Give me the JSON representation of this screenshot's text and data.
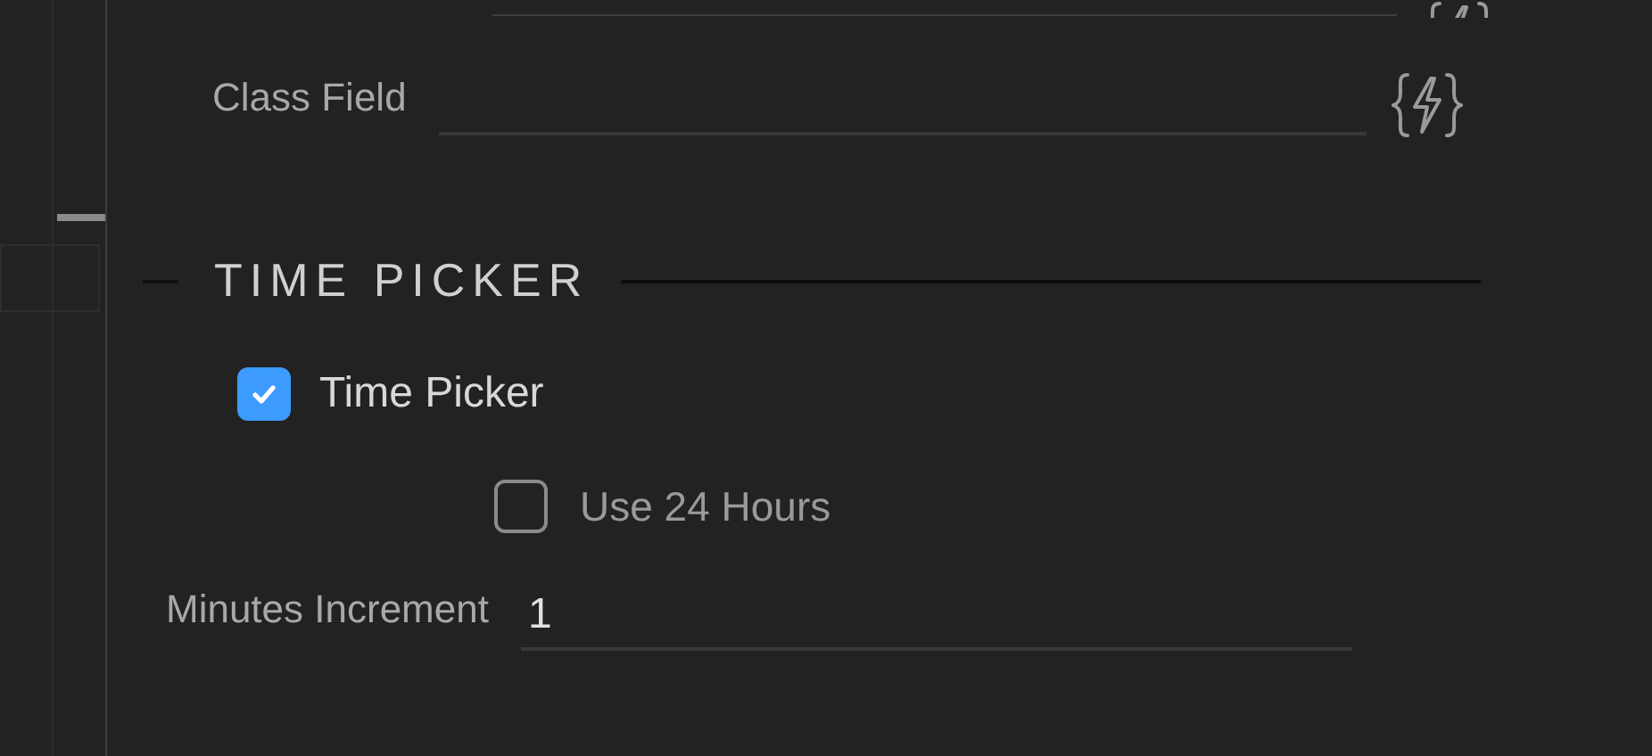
{
  "fields_above": [
    {
      "label": "Class Field"
    }
  ],
  "section": {
    "title": "TIME PICKER"
  },
  "time_picker": {
    "label": "Time Picker",
    "checked": true
  },
  "use_24_hours": {
    "label": "Use 24 Hours",
    "checked": false
  },
  "minutes_increment": {
    "label": "Minutes Increment",
    "value": "1"
  }
}
